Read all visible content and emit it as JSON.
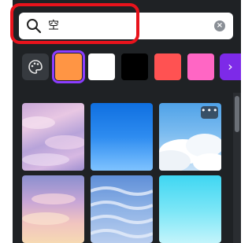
{
  "search": {
    "query": "空",
    "clear_symbol": "×"
  },
  "colors": {
    "highlight": "#e8131c",
    "selected_outline": "#8b3dff",
    "swatches": [
      "#ff9544",
      "#ffffff",
      "#000000",
      "#ff5252",
      "#ff66c4"
    ]
  },
  "scroll_right_symbol": "›",
  "results": {
    "more_symbol": "•••",
    "images": [
      {
        "name": "pastel-cloudy-sky"
      },
      {
        "name": "clear-blue-sky"
      },
      {
        "name": "white-clouds-blue-sky"
      },
      {
        "name": "sunset-pink-clouds"
      },
      {
        "name": "rippled-clouds-sky"
      },
      {
        "name": "cyan-gradient-sky"
      }
    ]
  },
  "icons": {
    "search": "search-icon",
    "palette": "palette-icon",
    "clear": "clear-icon",
    "scroll": "chevron-right-icon"
  }
}
